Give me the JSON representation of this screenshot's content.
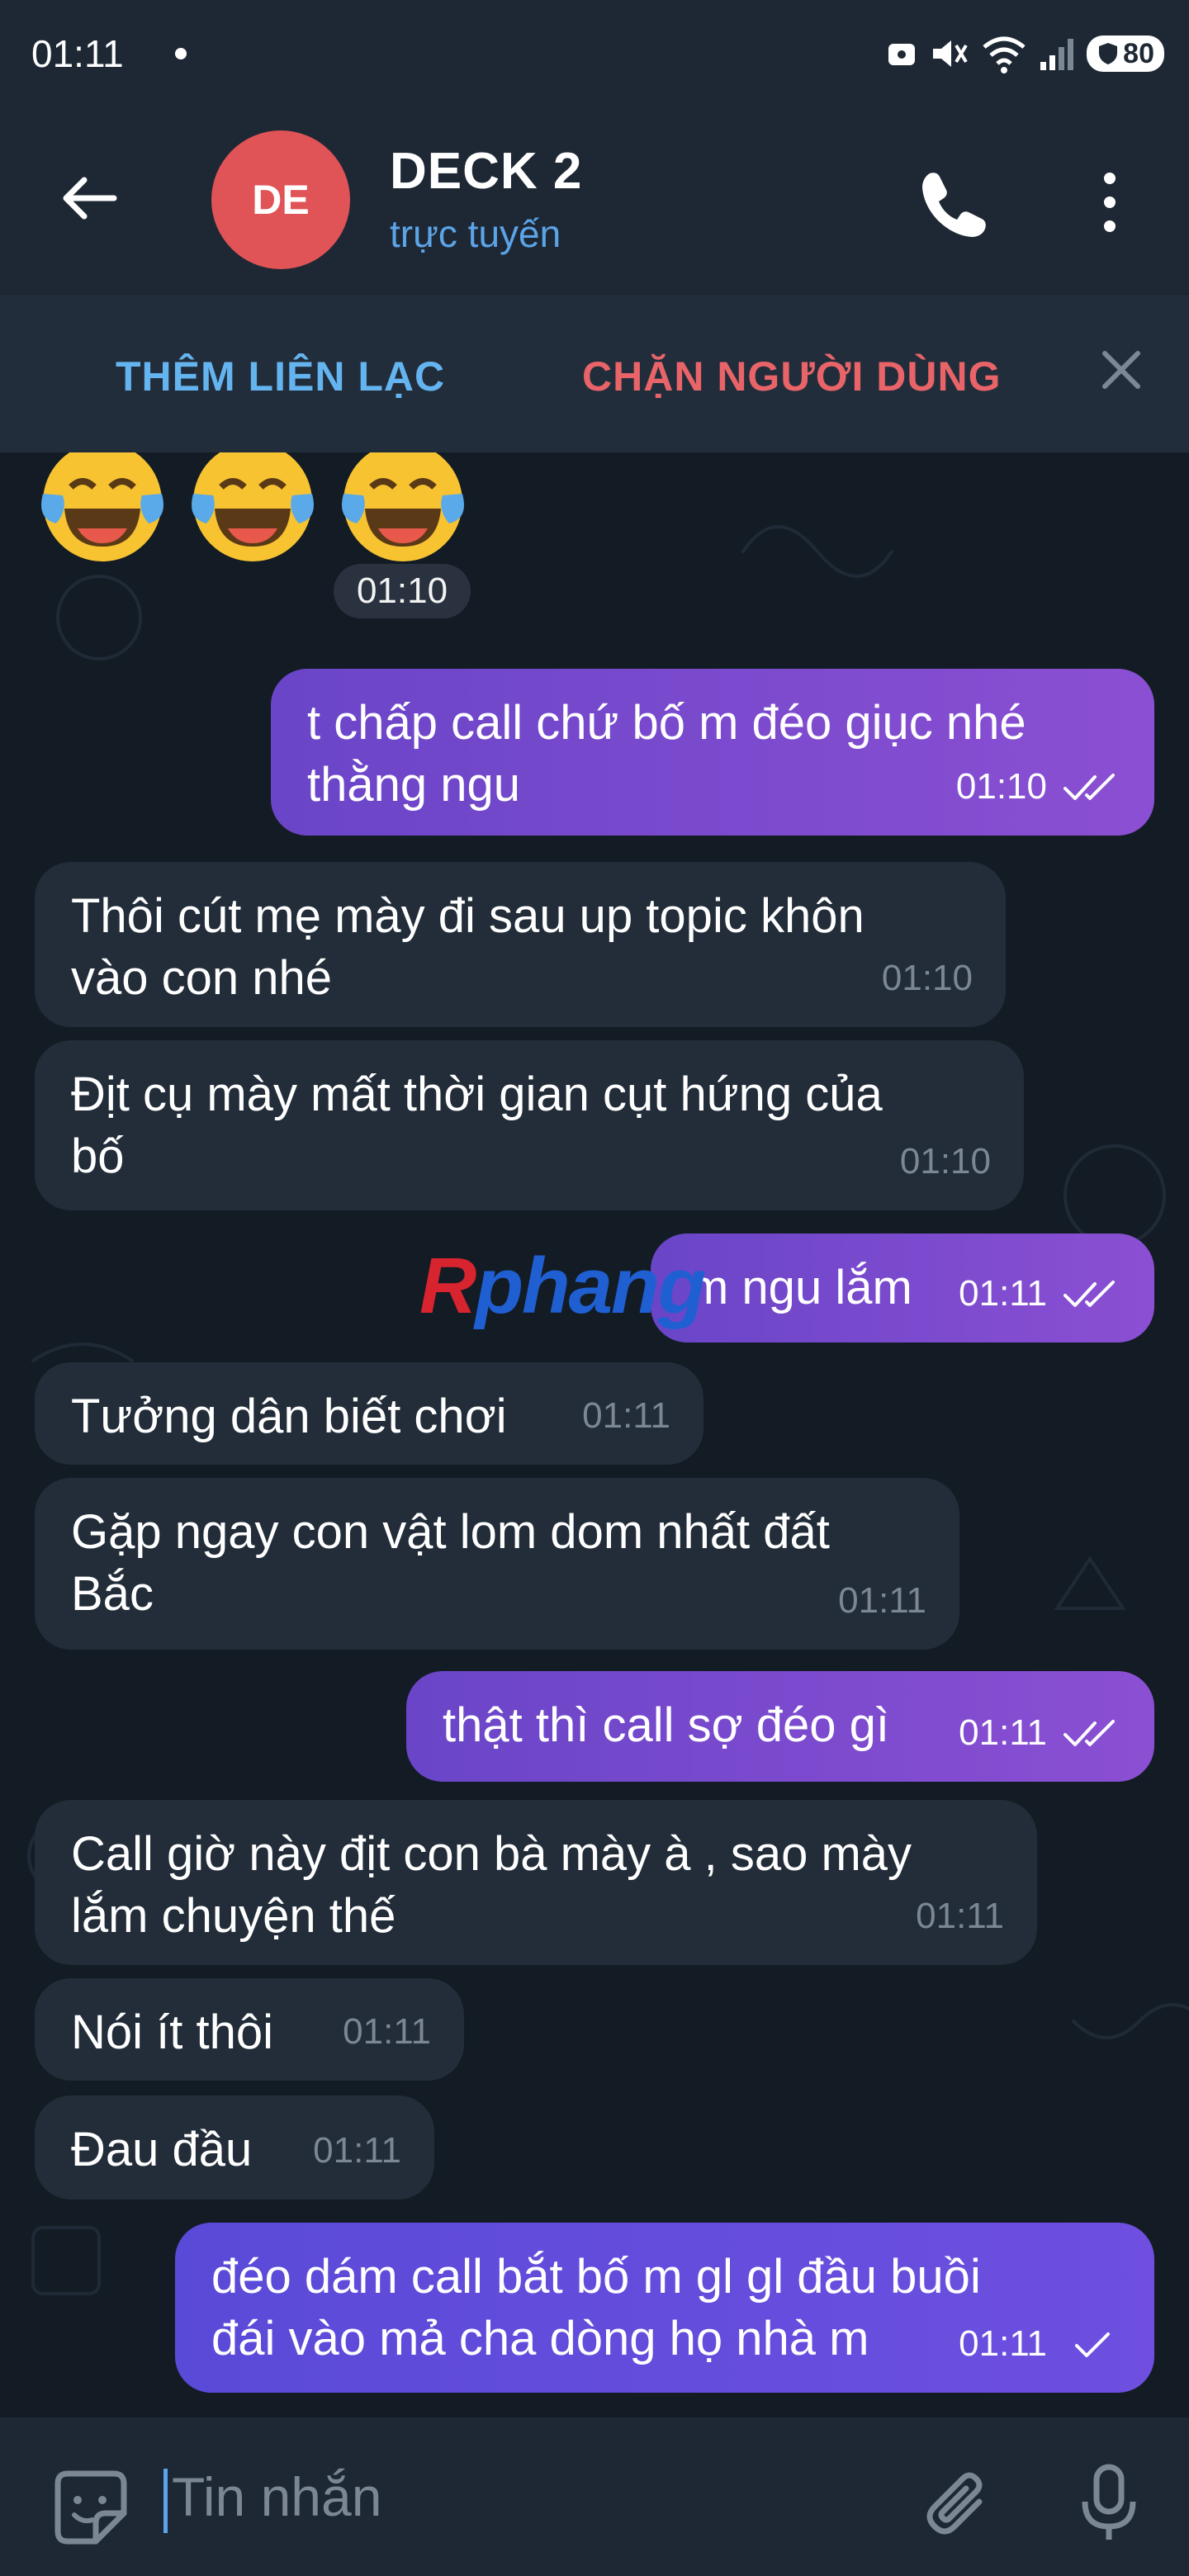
{
  "status_bar": {
    "time": "01:11",
    "battery": "80"
  },
  "header": {
    "avatar_initials": "DE",
    "title": "DECK 2",
    "subtitle": "trực tuyến"
  },
  "action_bar": {
    "add_contact": "THÊM LIÊN LẠC",
    "block_user": "CHẶN NGƯỜI DÙNG"
  },
  "top": {
    "emoji": "😂😂😂",
    "time": "01:10"
  },
  "messages": [
    {
      "dir": "out",
      "text": "t chấp call chứ bố m đéo giục nhé\nthằng ngu",
      "time": "01:10",
      "ticks": "double"
    },
    {
      "dir": "in",
      "text": "Thôi cút mẹ mày đi sau up topic khôn\nvào con nhé",
      "time": "01:10"
    },
    {
      "dir": "in",
      "text": "Địt cụ mày mất thời gian cụt hứng của\nbố",
      "time": "01:10"
    },
    {
      "dir": "out",
      "text": "m ngu lắm",
      "time": "01:11",
      "ticks": "double"
    },
    {
      "dir": "in",
      "text": "Tưởng dân biết chơi",
      "time": "01:11"
    },
    {
      "dir": "in",
      "text": "Gặp ngay con vật lom dom nhất đất\nBắc",
      "time": "01:11"
    },
    {
      "dir": "out",
      "text": "thật thì call sợ đéo gì",
      "time": "01:11",
      "ticks": "double"
    },
    {
      "dir": "in",
      "text": "Call giờ này địt con bà mày à , sao mày\nlắm chuyện thế",
      "time": "01:11"
    },
    {
      "dir": "in",
      "text": "Nói ít thôi",
      "time": "01:11"
    },
    {
      "dir": "in",
      "text": "Đau đầu",
      "time": "01:11"
    },
    {
      "dir": "out",
      "text": "đéo dám call bắt bố m gl gl đầu buồi\nđái vào mả cha dòng họ nhà m",
      "time": "01:11",
      "ticks": "single"
    }
  ],
  "watermark": {
    "part1": "R",
    "part2": "phang"
  },
  "input": {
    "placeholder": "Tin nhắn"
  },
  "colors": {
    "header_bg": "#1e2834",
    "chat_bg": "#131c25",
    "incoming_bubble": "#222d39",
    "outgoing_bubble": "#8b4fd3",
    "accent": "#5ca4e8",
    "danger": "#e86468",
    "avatar": "#e05356"
  },
  "icons": [
    "back-arrow-icon",
    "phone-icon",
    "more-vertical-icon",
    "close-icon",
    "double-check-icon",
    "check-icon",
    "sticker-icon",
    "attach-icon",
    "mic-icon"
  ]
}
